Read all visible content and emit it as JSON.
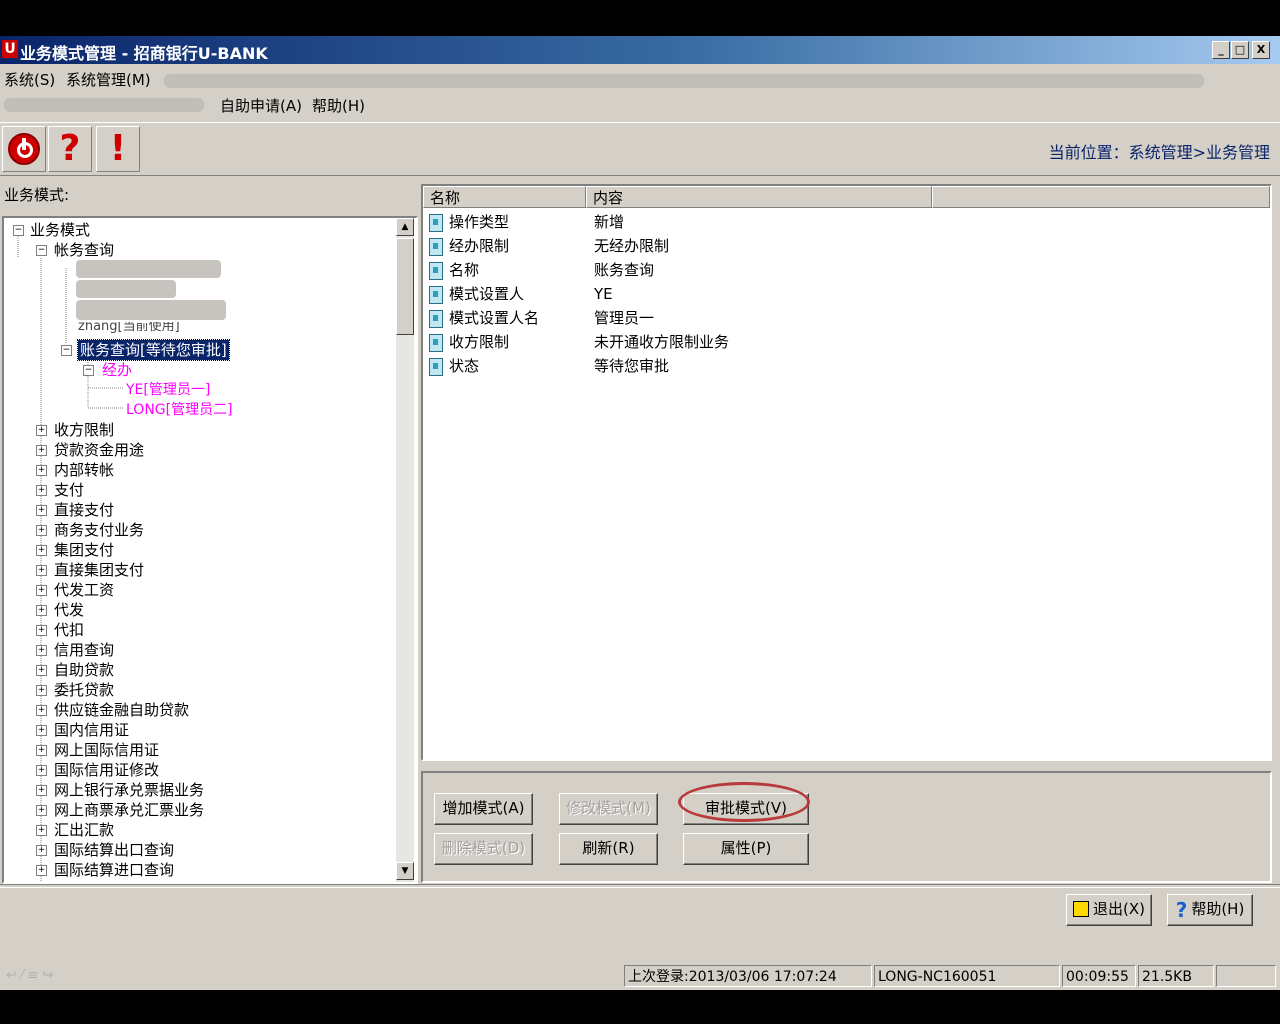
{
  "window": {
    "title": "业务模式管理 - 招商银行U-BANK",
    "controls": [
      "_",
      "□",
      "X"
    ]
  },
  "menubar": {
    "row1": [
      "系统(S)",
      "系统管理(M)"
    ],
    "row2": [
      "自助申请(A)",
      "帮助(H)"
    ]
  },
  "toolbar": {
    "exit_glyph": "",
    "help_glyph": "?",
    "alert_glyph": "!",
    "location": "当前位置：系统管理>业务管理"
  },
  "left_panel": {
    "label": "业务模式:",
    "tree": {
      "root": "业务模式",
      "account_query": "帐务查询",
      "partial_visible": "zhang[当前使用]",
      "pending_item": "账务查询[等待您审批]",
      "handler": "经办",
      "handler_users": [
        "YE[管理员一]",
        "LONG[管理员二]"
      ],
      "categories": [
        "收方限制",
        "贷款资金用途",
        "内部转帐",
        "支付",
        "直接支付",
        "商务支付业务",
        "集团支付",
        "直接集团支付",
        "代发工资",
        "代发",
        "代扣",
        "信用查询",
        "自助贷款",
        "委托贷款",
        "供应链金融自助贷款",
        "国内信用证",
        "网上国际信用证",
        "国际信用证修改",
        "网上银行承兑票据业务",
        "网上商票承兑汇票业务",
        "汇出汇款",
        "国际结算出口查询",
        "国际结算进口查询"
      ]
    }
  },
  "list": {
    "headers": [
      "名称",
      "内容",
      ""
    ],
    "rows": [
      {
        "name": "操作类型",
        "value": "新增"
      },
      {
        "name": "经办限制",
        "value": "无经办限制"
      },
      {
        "name": "名称",
        "value": "账务查询"
      },
      {
        "name": "模式设置人",
        "value": "YE"
      },
      {
        "name": "模式设置人名",
        "value": "管理员一"
      },
      {
        "name": "收方限制",
        "value": "未开通收方限制业务"
      },
      {
        "name": "状态",
        "value": "等待您审批"
      }
    ]
  },
  "buttons": {
    "add": "增加模式(A)",
    "modify": "修改模式(M)",
    "approve": "审批模式(V)",
    "delete": "删除模式(D)",
    "refresh": "刷新(R)",
    "properties": "属性(P)"
  },
  "bottom_buttons": {
    "exit": "退出(X)",
    "help": "帮助(H)"
  },
  "status": {
    "last_login": "上次登录:2013/03/06 17:07:24",
    "user": "LONG-NC160051",
    "elapsed": "00:09:55",
    "size": "21.5KB"
  },
  "colors": {
    "title_gradient_start": "#0a246a",
    "window_bg": "#d4d0c8",
    "highlight_ellipse": "#b83a3a",
    "tree_magenta": "#ff00ff"
  }
}
